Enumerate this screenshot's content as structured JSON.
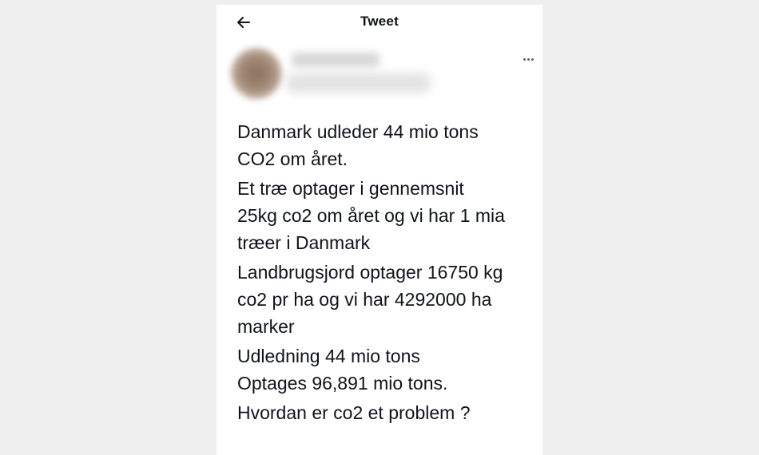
{
  "header": {
    "title": "Tweet",
    "back_icon": "arrow-left-icon"
  },
  "author": {
    "avatar": "blurred-avatar",
    "name_blurred": true,
    "more_icon": "more-horizontal-icon"
  },
  "tweet": {
    "paragraphs": [
      "Danmark udleder 44 mio tons\nCO2 om året.",
      "Et træ optager i gennemsnit\n25kg co2 om året og vi har 1 mia\ntræer i Danmark",
      "Landbrugsjord optager 16750 kg\nco2 pr ha og vi har 4292000 ha\nmarker",
      "Udledning 44 mio tons\nOptages 96,891 mio tons.",
      "Hvordan er co2 et problem ?"
    ]
  }
}
